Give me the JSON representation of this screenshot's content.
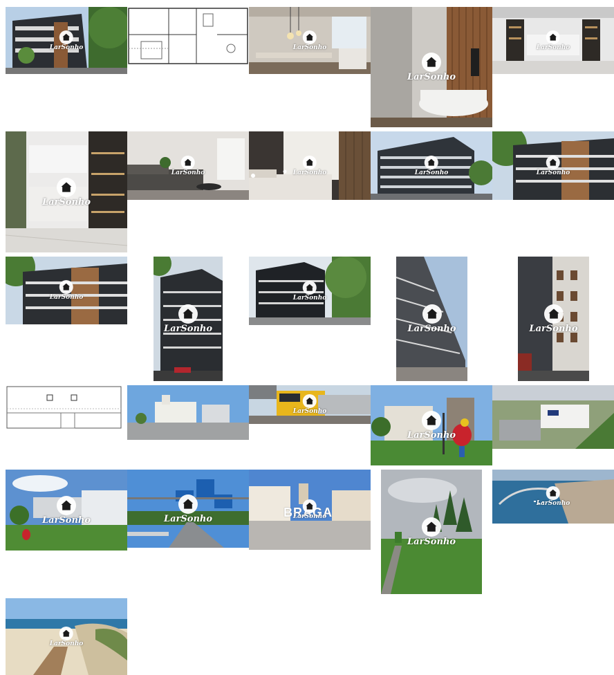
{
  "gallery": {
    "watermark": "LarSonho",
    "sign_word": "BRAGA",
    "tiles": [
      {
        "id": "exterior-1"
      },
      {
        "id": "floorplan-1"
      },
      {
        "id": "dining"
      },
      {
        "id": "bathroom"
      },
      {
        "id": "kitchen-1"
      },
      {
        "id": "kitchen-2"
      },
      {
        "id": "living"
      },
      {
        "id": "bedroom"
      },
      {
        "id": "exterior-2"
      },
      {
        "id": "exterior-3"
      },
      {
        "id": "exterior-4"
      },
      {
        "id": "exterior-5"
      },
      {
        "id": "exterior-6"
      },
      {
        "id": "exterior-7"
      },
      {
        "id": "exterior-8"
      },
      {
        "id": "floorplan-2"
      },
      {
        "id": "church"
      },
      {
        "id": "train"
      },
      {
        "id": "square-rooster"
      },
      {
        "id": "university"
      },
      {
        "id": "stadium"
      },
      {
        "id": "highway"
      },
      {
        "id": "braga-sign"
      },
      {
        "id": "city-park"
      },
      {
        "id": "marina"
      },
      {
        "id": "beach"
      }
    ]
  },
  "colors": {
    "sky": "#a9c6e4",
    "facade_dark": "#2b2e33",
    "wood": "#8a5a36",
    "grass": "#4d8a34",
    "road": "#8a8d90",
    "sign_blue": "#1c5fb0",
    "train_yellow": "#e8b61c",
    "rooster_red": "#c8232c",
    "sea": "#2f6f9c"
  }
}
